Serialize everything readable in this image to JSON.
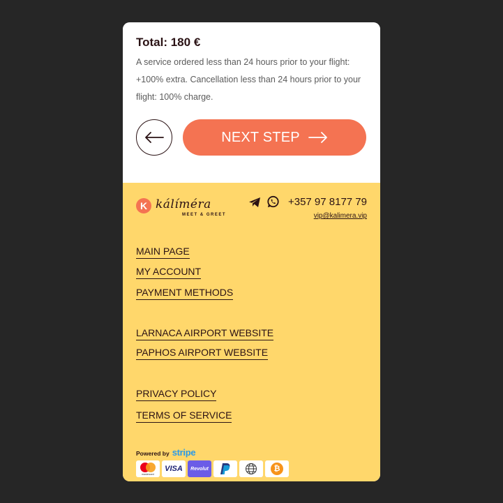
{
  "summary": {
    "total": "Total: 180 €",
    "note": "A service ordered less than 24 hours prior to your flight: +100% extra. Cancellation less than 24 hours prior to your flight: 100% charge."
  },
  "actions": {
    "back_icon": "arrow-left-icon",
    "next_label": "NEXT STEP",
    "next_icon": "arrow-right-icon"
  },
  "footer": {
    "logo": {
      "letter": "K",
      "word": "kálíméra",
      "tagline": "MEET & GREET"
    },
    "contacts": {
      "icons": [
        "telegram-icon",
        "whatsapp-icon"
      ],
      "phone": "+357 97 8177 79",
      "email": "vip@kalimera.vip"
    },
    "links": [
      {
        "label": "MAIN PAGE"
      },
      {
        "label": "MY ACCOUNT"
      },
      {
        "label": "PAYMENT METHODS"
      },
      {
        "label": "LARNACA AIRPORT WEBSITE"
      },
      {
        "label": "PAPHOS AIRPORT WEBSITE"
      },
      {
        "label": "PRIVACY POLICY"
      },
      {
        "label": "TERMS OF SERVICE"
      }
    ],
    "powered_by": "Powered by",
    "stripe": "stripe",
    "payment_methods": [
      {
        "name": "mastercard-icon",
        "caption": "mastercard"
      },
      {
        "name": "visa-icon",
        "label": "VISA"
      },
      {
        "name": "revolut-icon",
        "label": "Revolut"
      },
      {
        "name": "paypal-icon"
      },
      {
        "name": "globe-icon"
      },
      {
        "name": "bitcoin-icon",
        "label": "₿"
      }
    ]
  },
  "colors": {
    "accent": "#f47352",
    "footer_bg": "#ffd76b",
    "text_dark": "#2a1214",
    "page_bg": "#262626"
  }
}
